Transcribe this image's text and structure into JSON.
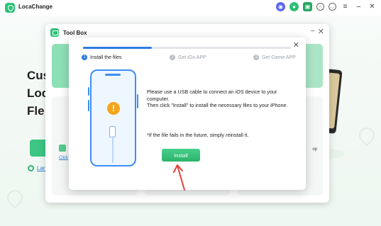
{
  "app": {
    "name": "LocaChange"
  },
  "hero": {
    "line1": "Cus",
    "line2": "Loc",
    "line3": "Fle",
    "radio_label": "Lan"
  },
  "toolbox": {
    "title": "Tool Box",
    "cards": [
      {
        "link": "Click"
      },
      {
        "text": ""
      },
      {
        "text": "op"
      }
    ]
  },
  "dialog": {
    "progress": 0.33,
    "steps": [
      {
        "number": "1",
        "label": "Install the files",
        "active": true
      },
      {
        "number": "2",
        "label": "Get iGo APP",
        "active": false
      },
      {
        "number": "3",
        "label": "Get Game APP",
        "active": false
      }
    ],
    "instructions": [
      "Please use a USB cable to connect an iOS device to your computer.",
      "Then click \"Install\" to install the necessary files to your iPhone."
    ],
    "note": "*If the file fails in the future, simply reinstall it.",
    "install_label": "Install",
    "warning_glyph": "!"
  },
  "colors": {
    "accent_green": "#2fc27a",
    "accent_blue": "#2d7be0",
    "warning": "#f3a51c",
    "arrow": "#e0443a"
  },
  "icons": [
    "app-logo-icon",
    "discord-icon",
    "avatar-icon",
    "store-icon",
    "headset-icon",
    "chat-icon",
    "menu-icon",
    "minimize-icon",
    "close-icon",
    "toolbox-icon",
    "warning-icon",
    "usb-cable-icon",
    "phone-icon",
    "arrow-icon"
  ]
}
